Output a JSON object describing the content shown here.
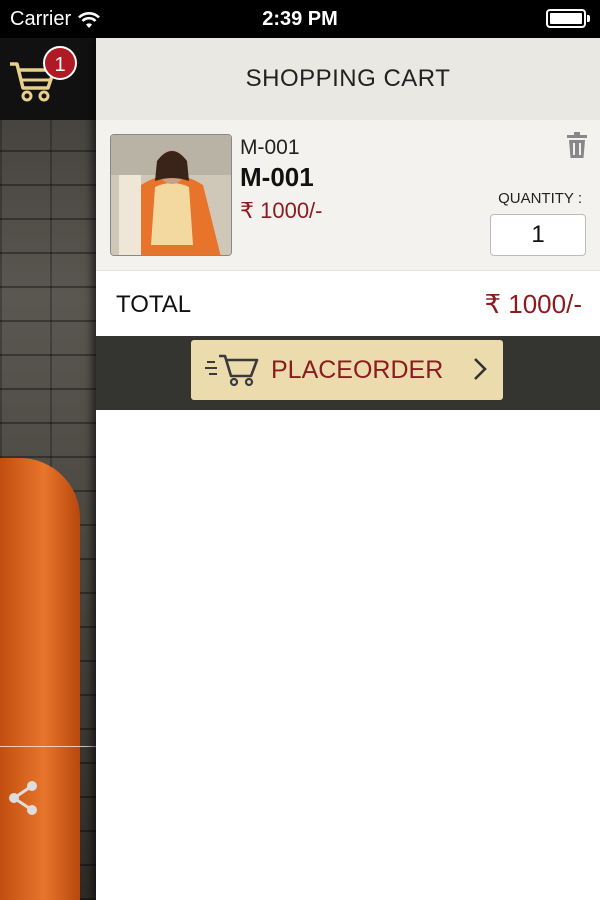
{
  "status_bar": {
    "carrier": "Carrier",
    "time": "2:39 PM"
  },
  "sidebar": {
    "cart_count": "1"
  },
  "drawer": {
    "title": "SHOPPING CART",
    "items": [
      {
        "code": "M-001",
        "name": "M-001",
        "price": "₹ 1000/-",
        "quantity_label": "QUANTITY :",
        "quantity": "1"
      }
    ],
    "total_label": "TOTAL",
    "total_value": "₹ 1000/-",
    "place_order_label": "PLACEORDER"
  },
  "colors": {
    "accent": "#8c1a1f",
    "button_bg": "#ecdcad",
    "header_bg": "#e9e8e3",
    "order_bar_bg": "#343431"
  },
  "icons": [
    "cart-icon",
    "wifi-icon",
    "share-icon",
    "trash-icon",
    "fast-cart-icon",
    "chevron-right-icon"
  ]
}
